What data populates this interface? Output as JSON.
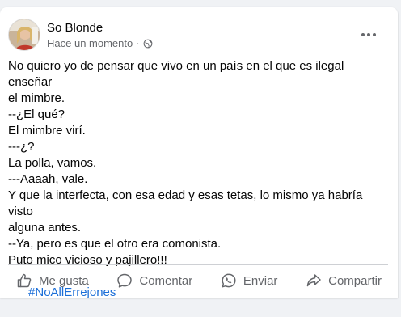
{
  "post": {
    "author": "So Blonde",
    "timestamp": "Hace un momento",
    "separator": "·",
    "privacy_icon": "globe-icon",
    "more_icon": "more-horizontal-icon",
    "lines": [
      "No quiero yo de pensar que vivo en un país en el que es ilegal enseñar",
      "el mimbre.",
      "--¿El qué?",
      "El mimbre virí.",
      "---¿?",
      "La polla, vamos.",
      "---Aaaah, vale.",
      "Y que la interfecta, con esa edad y esas tetas, lo mismo ya habría visto",
      "alguna antes.",
      "--Ya, pero es que el otro era comonista.",
      "Puto mico vicioso y pajillero!!!"
    ],
    "hashtag": "#NoAllErrejones"
  },
  "actions": {
    "like": "Me gusta",
    "comment": "Comentar",
    "send": "Enviar",
    "share": "Compartir"
  },
  "colors": {
    "hashtag": "#1a6ed8",
    "secondary_text": "#65676b",
    "background": "#f0f2f5"
  }
}
